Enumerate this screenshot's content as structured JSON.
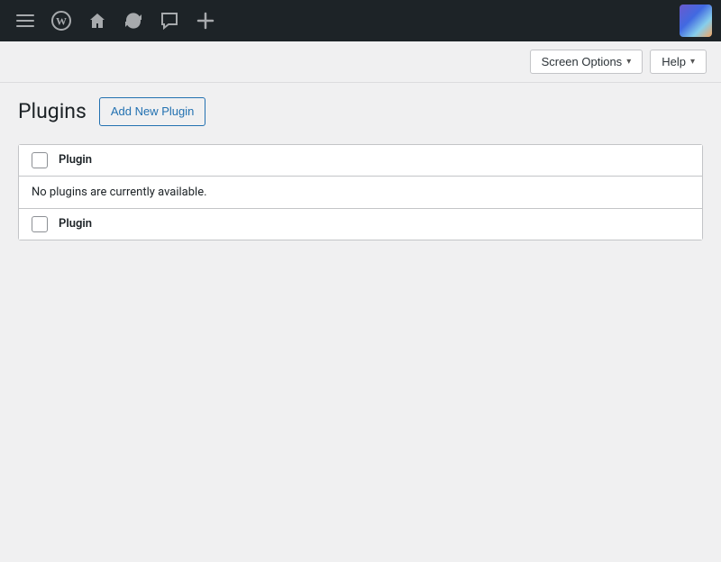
{
  "adminBar": {
    "icons": [
      {
        "name": "menu-toggle-icon",
        "symbol": "☰"
      },
      {
        "name": "wp-logo-icon",
        "symbol": "W"
      },
      {
        "name": "home-icon",
        "symbol": "⌂"
      },
      {
        "name": "updates-icon",
        "symbol": "↻"
      },
      {
        "name": "comments-icon",
        "symbol": "✉"
      },
      {
        "name": "new-content-icon",
        "symbol": "+"
      }
    ]
  },
  "toolbar": {
    "screenOptions": "Screen Options",
    "help": "Help"
  },
  "page": {
    "title": "Plugins",
    "addNewLabel": "Add New Plugin"
  },
  "table": {
    "headerCheckboxLabel": "",
    "columnLabel": "Plugin",
    "emptyMessage": "No plugins are currently available.",
    "footerCheckboxLabel": "",
    "footerColumnLabel": "Plugin"
  }
}
